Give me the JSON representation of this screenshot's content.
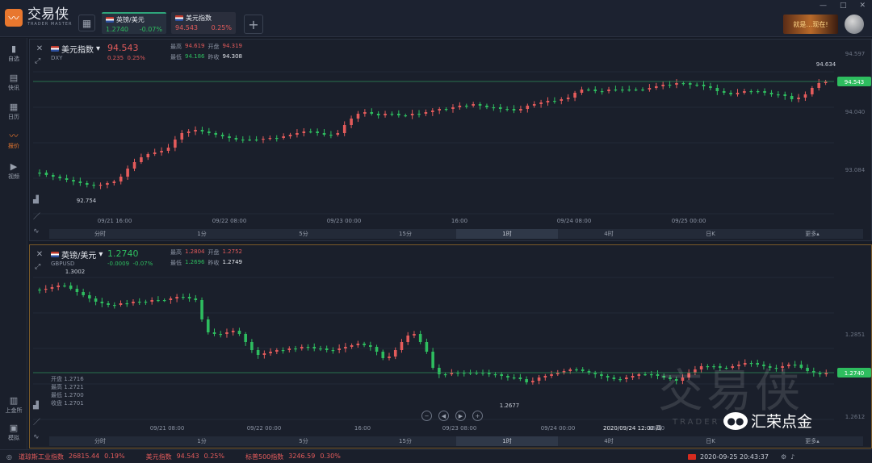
{
  "app": {
    "name": "交易侠",
    "subtitle": "TRADER MASTER"
  },
  "window_controls": [
    "—",
    "□",
    "✕"
  ],
  "tabs": [
    {
      "name": "英镑/美元",
      "price": "1.2740",
      "change": "-0.07%",
      "color": "green"
    },
    {
      "name": "美元指数",
      "price": "94.543",
      "change": "0.25%",
      "color": "red"
    }
  ],
  "ad_text": "就是…现在!",
  "sidebar": [
    {
      "label": "自选",
      "icon": "bookmark-icon"
    },
    {
      "label": "快讯",
      "icon": "news-icon"
    },
    {
      "label": "日历",
      "icon": "calendar-icon"
    },
    {
      "label": "报价",
      "icon": "quote-icon",
      "active": true
    },
    {
      "label": "视频",
      "icon": "video-icon"
    },
    {
      "label": "上金所",
      "icon": "exchange-icon"
    },
    {
      "label": "模拟",
      "icon": "simulate-icon"
    }
  ],
  "panel1": {
    "name": "美元指数",
    "code": "DXY",
    "price": "94.543",
    "change_abs": "0.235",
    "change_pct": "0.25%",
    "high_label": "最高",
    "high": "94.619",
    "open_label": "开盘",
    "open": "94.319",
    "low_label": "最低",
    "low": "94.186",
    "prev_label": "昨收",
    "prev": "94.308",
    "y_ticks": [
      "94.597",
      "94.040",
      "93.084"
    ],
    "last_label": "94.543",
    "hover_label": "94.634",
    "min_label": "92.754",
    "x_ticks": [
      "09/21 16:00",
      "09/22 08:00",
      "09/23 00:00",
      "16:00",
      "09/24 08:00",
      "09/25 00:00"
    ]
  },
  "panel2": {
    "name": "英镑/美元",
    "code": "GBPUSD",
    "price": "1.2740",
    "change_abs": "-0.0009",
    "change_pct": "-0.07%",
    "high_label": "最高",
    "high": "1.2804",
    "open_label": "开盘",
    "open": "1.2752",
    "low_label": "最低",
    "low": "1.2696",
    "prev_label": "昨收",
    "prev": "1.2749",
    "y_ticks": [
      "1.2851",
      "1.2612"
    ],
    "last_label": "1.2740",
    "max_label": "1.3002",
    "min_label": "1.2677",
    "cursor_time": "2020/09/24 12:00 四",
    "ohlc_box": [
      "开盘 1.2716",
      "最高 1.2721",
      "最低 1.2700",
      "收盘 1.2701"
    ],
    "x_ticks": [
      "09/21 08:00",
      "09/22 00:00",
      "16:00",
      "09/23 08:00",
      "09/24 00:00",
      "16:00"
    ]
  },
  "timeframes": [
    "分时",
    "1分",
    "5分",
    "15分",
    "1时",
    "4时",
    "日K",
    "更多▴"
  ],
  "active_timeframe": "1时",
  "statusbar": [
    {
      "name": "道琼斯工业指数",
      "price": "26815.44",
      "change": "0.19%"
    },
    {
      "name": "美元指数",
      "price": "94.543",
      "change": "0.25%"
    },
    {
      "name": "标普500指数",
      "price": "3246.59",
      "change": "0.30%"
    }
  ],
  "clock": "2020-09-25 20:43:37",
  "watermark": "交易侠",
  "watermark_sub": "TRADER",
  "wechat_label": "汇荣点金",
  "colors": {
    "up": "#e35b5b",
    "down": "#2ebd5f",
    "accent": "#e8772e"
  }
}
